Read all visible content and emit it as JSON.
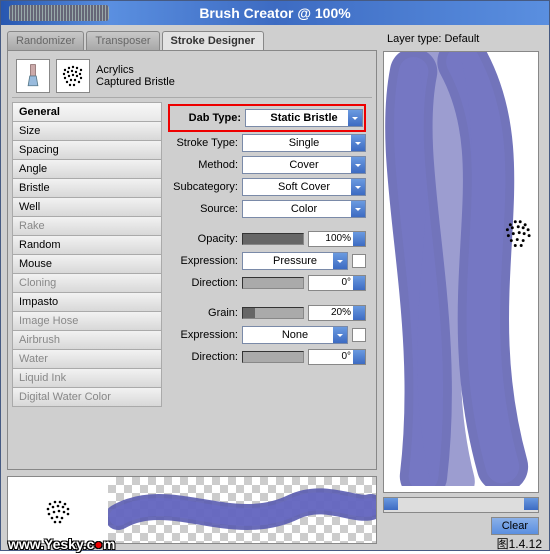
{
  "window": {
    "title": "Brush Creator @ 100%"
  },
  "tabs": {
    "randomizer": "Randomizer",
    "transposer": "Transposer",
    "stroke_designer": "Stroke Designer"
  },
  "brush": {
    "variant": "Acrylics",
    "subvariant": "Captured Bristle"
  },
  "categories": [
    {
      "label": "General",
      "sel": true
    },
    {
      "label": "Size"
    },
    {
      "label": "Spacing"
    },
    {
      "label": "Angle"
    },
    {
      "label": "Bristle"
    },
    {
      "label": "Well"
    },
    {
      "label": "Rake",
      "dis": true
    },
    {
      "label": "Random"
    },
    {
      "label": "Mouse"
    },
    {
      "label": "Cloning",
      "dis": true
    },
    {
      "label": "Impasto"
    },
    {
      "label": "Image Hose",
      "dis": true
    },
    {
      "label": "Airbrush",
      "dis": true
    },
    {
      "label": "Water",
      "dis": true
    },
    {
      "label": "Liquid Ink",
      "dis": true
    },
    {
      "label": "Digital Water Color",
      "dis": true
    }
  ],
  "props": {
    "dab_type": {
      "label": "Dab Type:",
      "value": "Static Bristle"
    },
    "stroke_type": {
      "label": "Stroke Type:",
      "value": "Single"
    },
    "method": {
      "label": "Method:",
      "value": "Cover"
    },
    "subcategory": {
      "label": "Subcategory:",
      "value": "Soft Cover"
    },
    "source": {
      "label": "Source:",
      "value": "Color"
    },
    "opacity": {
      "label": "Opacity:",
      "value": "100%",
      "fill": 100
    },
    "expression1": {
      "label": "Expression:",
      "value": "Pressure"
    },
    "direction1": {
      "label": "Direction:",
      "value": "0°",
      "fill": 0
    },
    "grain": {
      "label": "Grain:",
      "value": "20%",
      "fill": 20
    },
    "expression2": {
      "label": "Expression:",
      "value": "None"
    },
    "direction2": {
      "label": "Direction:",
      "value": "0°",
      "fill": 0
    }
  },
  "right": {
    "layer_type_label": "Layer type:",
    "layer_type_value": "Default",
    "clear": "Clear"
  },
  "caption": "图1.4.12",
  "watermark_pre": "www.Yesky.c",
  "watermark_ball": "●",
  "watermark_post": "m"
}
